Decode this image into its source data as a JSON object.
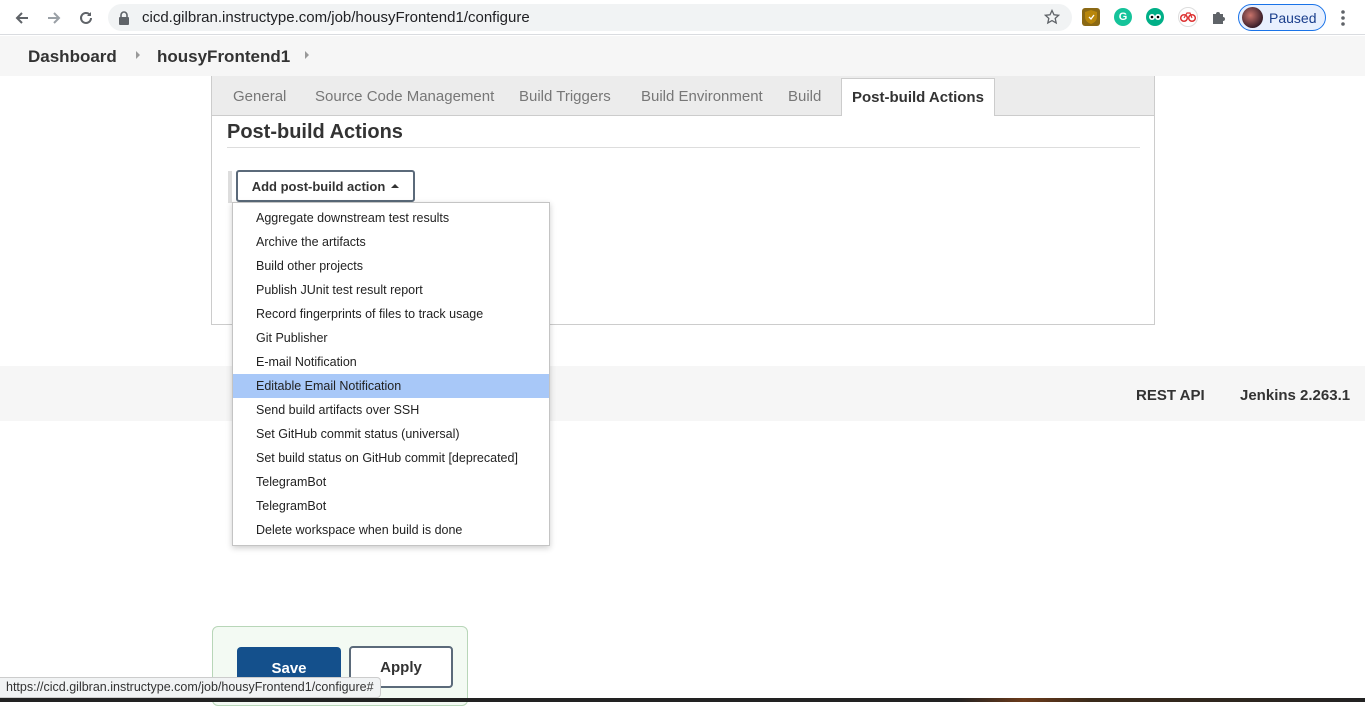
{
  "browser": {
    "url": "cicd.gilbran.instructype.com/job/housyFrontend1/configure",
    "profile_label": "Paused",
    "extensions": [
      "shield-extension-icon",
      "grammarly-icon",
      "tripadvisor-icon",
      "cycling-extension-icon",
      "puzzle-icon"
    ],
    "status_url": "https://cicd.gilbran.instructype.com/job/housyFrontend1/configure#"
  },
  "breadcrumb": {
    "items": [
      "Dashboard",
      "housyFrontend1"
    ]
  },
  "tabs": [
    {
      "label": "General"
    },
    {
      "label": "Source Code Management"
    },
    {
      "label": "Build Triggers"
    },
    {
      "label": "Build Environment"
    },
    {
      "label": "Build"
    },
    {
      "label": "Post-build Actions",
      "active": true
    }
  ],
  "section": {
    "title": "Post-build Actions",
    "add_button_label": "Add post-build action"
  },
  "dropdown": {
    "items": [
      "Aggregate downstream test results",
      "Archive the artifacts",
      "Build other projects",
      "Publish JUnit test result report",
      "Record fingerprints of files to track usage",
      "Git Publisher",
      "E-mail Notification",
      "Editable Email Notification",
      "Send build artifacts over SSH",
      "Set GitHub commit status (universal)",
      "Set build status on GitHub commit [deprecated]",
      "TelegramBot",
      "TelegramBot",
      "Delete workspace when build is done"
    ],
    "highlighted": "Editable Email Notification"
  },
  "footer": {
    "rest_api": "REST API",
    "version": "Jenkins 2.263.1"
  },
  "actions": {
    "save": "Save",
    "apply": "Apply"
  },
  "colors": {
    "save_blue": "#14508c",
    "highlight": "#a8c8f8",
    "profile_blue": "#1a73e8"
  }
}
